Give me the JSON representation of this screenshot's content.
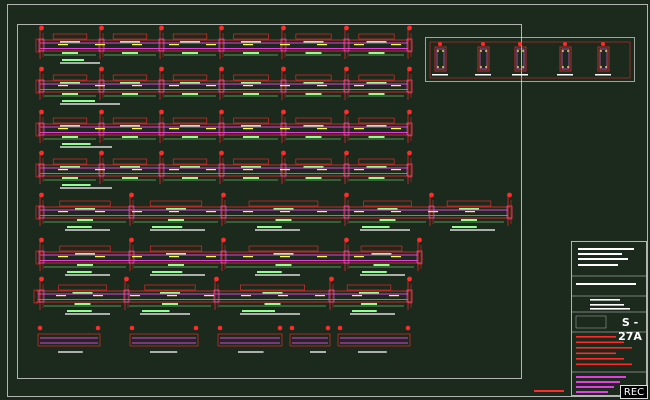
{
  "app": {
    "record_button_label": "REC"
  },
  "title_block": {
    "sheet_number": "S - 27A"
  },
  "colors": {
    "background": "#1b2a1c",
    "frame": "#d8d8d8",
    "beam": "#ff2b2b",
    "rebar": "#e040e0",
    "dimension": "#8fff8f",
    "annotation": "#ffffff",
    "highlight": "#ffff40",
    "stirrup": "#ff60ff"
  },
  "icons": {
    "record": "rec-label"
  }
}
